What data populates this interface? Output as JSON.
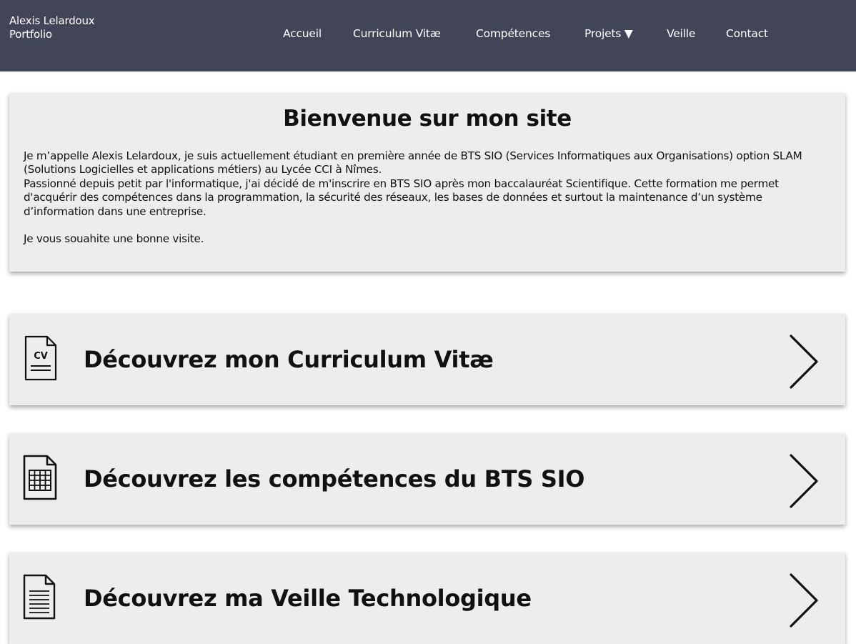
{
  "header": {
    "brand_line1": "Alexis Lelardoux",
    "brand_line2": "Portfolio",
    "nav": [
      {
        "label": "Accueil"
      },
      {
        "label": "Curriculum Vitæ"
      },
      {
        "label": "Compétences"
      },
      {
        "label": "Projets ▼"
      },
      {
        "label": "Veille"
      },
      {
        "label": "Contact"
      }
    ]
  },
  "welcome": {
    "title": "Bienvenue sur mon site",
    "paragraph1": "Je m’appelle Alexis Lelardoux, je suis actuellement étudiant en première année de BTS SIO (Services Informatiques aux Organisations) option SLAM (Solutions Logicielles et applications métiers) au Lycée CCI à Nîmes.",
    "paragraph2": "Passionné depuis petit par l'informatique, j'ai décidé de m'inscrire en BTS SIO après mon baccalauréat Scientifique. Cette formation me permet d'acquérir des compétences dans la programmation, la sécurité des réseaux, les bases de données et surtout la maintenance d’un système d’information dans une entreprise.",
    "paragraph3": "Je vous souahite une bonne visite."
  },
  "cards": [
    {
      "label": "Découvrez mon Curriculum Vitæ",
      "icon": "cv-document-icon",
      "icon_text": "CV"
    },
    {
      "label": "Découvrez les compétences du BTS SIO",
      "icon": "spreadsheet-document-icon"
    },
    {
      "label": "Découvrez ma Veille Technologique",
      "icon": "text-document-icon"
    }
  ],
  "colors": {
    "header_bg": "#424457",
    "card_bg": "#ededed"
  }
}
